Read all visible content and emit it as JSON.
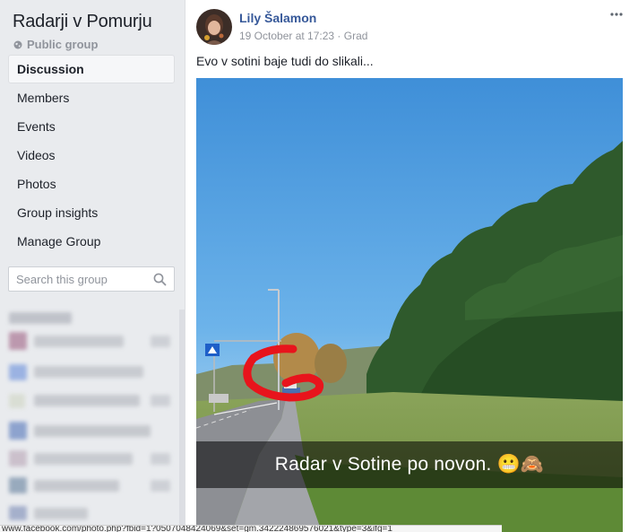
{
  "sidebar": {
    "group_title": "Radarji v Pomurju",
    "privacy_label": "Public group",
    "privacy_icon": "globe-icon",
    "nav_items": [
      {
        "label": "Discussion",
        "active": true
      },
      {
        "label": "Members",
        "active": false
      },
      {
        "label": "Events",
        "active": false
      },
      {
        "label": "Videos",
        "active": false
      },
      {
        "label": "Photos",
        "active": false
      },
      {
        "label": "Group insights",
        "active": false
      },
      {
        "label": "Manage Group",
        "active": false
      }
    ],
    "search": {
      "placeholder": "Search this group",
      "value": "",
      "icon": "search-icon"
    }
  },
  "post": {
    "author": "Lily Šalamon",
    "date": "19 October at 17:23",
    "separator": "·",
    "location": "Grad",
    "text": "Evo v sotini baje tudi do slikali...",
    "photo_caption": "Radar v Sotine po novon. 😬🙈",
    "more_options_icon": "ellipsis-icon"
  },
  "colors": {
    "link": "#365899",
    "secondary_text": "#90949c",
    "background": "#e9ebee",
    "annotation_red": "#e8141c",
    "sky": "#4a9ee0"
  },
  "status_bar": {
    "url": "www.facebook.com/photo.php?fbid=1?0507048424069&set=gm.342224869576021&type=3&ifg=1"
  }
}
